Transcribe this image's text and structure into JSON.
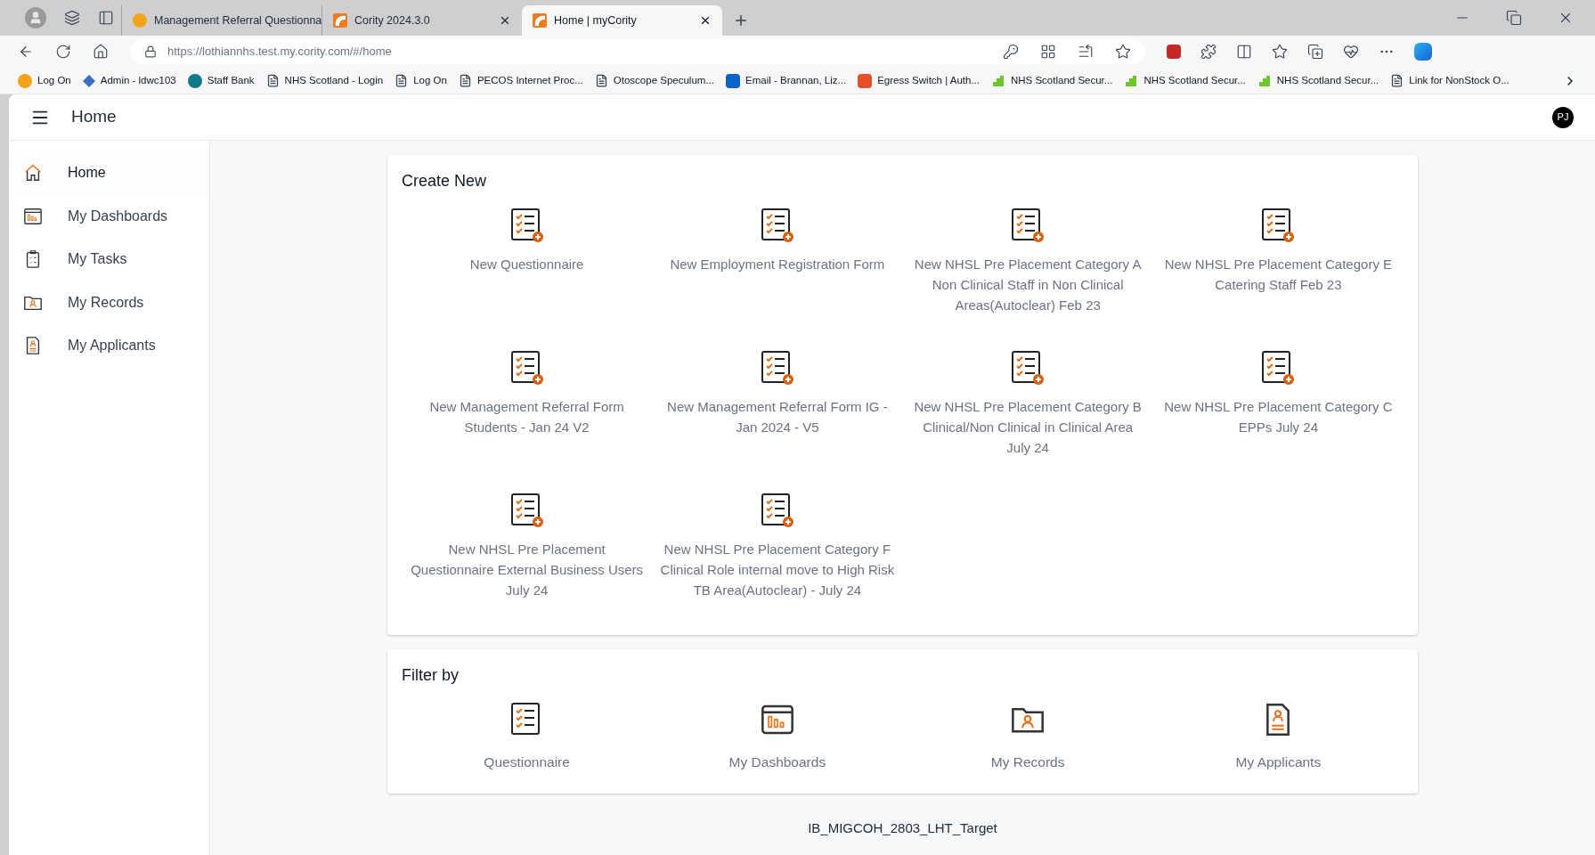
{
  "browser": {
    "tabs": [
      {
        "title": "Management Referral Questionna",
        "selected": false
      },
      {
        "title": "Cority 2024.3.0",
        "selected": false
      },
      {
        "title": "Home | myCority",
        "selected": true
      }
    ],
    "url": {
      "host": "https://lothiannhs.test.my.cority.com",
      "path": "/#/home"
    },
    "bookmarks": [
      "Log On",
      "Admin - ldwc103",
      "Staff Bank",
      "NHS Scotland - Login",
      "Log On",
      "PECOS Internet Proc...",
      "Otoscope Speculum...",
      "Email - Brannan, Liz...",
      "Egress Switch | Auth...",
      "NHS Scotland Secur...",
      "NHS Scotland Secur...",
      "NHS Scotland Secur...",
      "Link for NonStock O..."
    ]
  },
  "header": {
    "title": "Home",
    "avatar": "PJ"
  },
  "sidebar": {
    "items": [
      {
        "label": "Home",
        "selected": true
      },
      {
        "label": "My Dashboards",
        "selected": false
      },
      {
        "label": "My Tasks",
        "selected": false
      },
      {
        "label": "My Records",
        "selected": false
      },
      {
        "label": "My Applicants",
        "selected": false
      }
    ]
  },
  "create_new": {
    "title": "Create New",
    "items": [
      "New Questionnaire",
      "New Employment Registration Form",
      "New NHSL Pre Placement Category A Non Clinical Staff in Non Clinical Areas(Autoclear) Feb 23",
      "New NHSL Pre Placement Category E Catering Staff Feb 23",
      "New Management Referral Form Students - Jan 24 V2",
      "New Management Referral Form IG - Jan 2024 - V5",
      "New NHSL Pre Placement Category B Clinical/Non Clinical in Clinical Area July 24",
      "New NHSL Pre Placement Category C EPPs July 24",
      "New NHSL Pre Placement Questionnaire External Business Users July 24",
      "New NHSL Pre Placement Category F Clinical Role internal move to High Risk TB Area(Autoclear) - July 24"
    ]
  },
  "filter_by": {
    "title": "Filter by",
    "items": [
      "Questionnaire",
      "My Dashboards",
      "My Records",
      "My Applicants"
    ]
  },
  "footer": "IB_MIGCOH_2803_LHT_Target"
}
